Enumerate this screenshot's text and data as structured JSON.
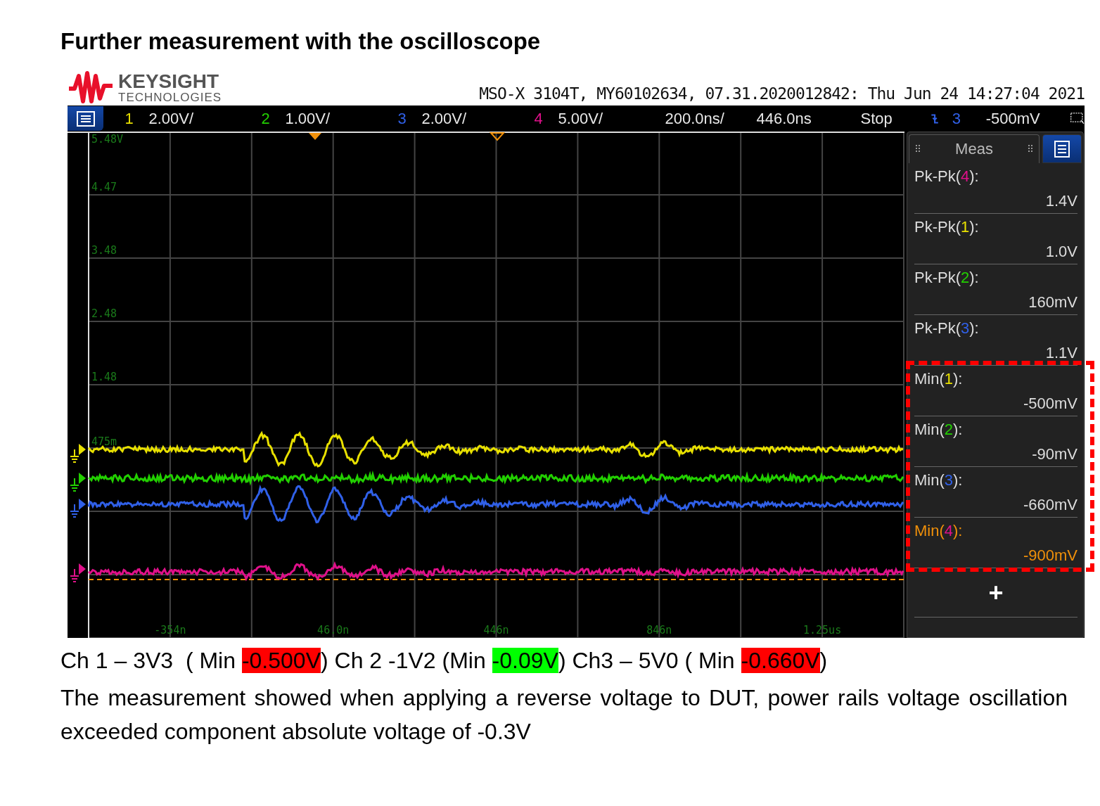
{
  "title": "Further measurement with the oscilloscope",
  "logo": {
    "brand": "KEYSIGHT",
    "subtitle": "TECHNOLOGIES"
  },
  "scope_header": "MSO-X 3104T, MY60102634, 07.31.2020012842: Thu Jun 24 14:27:04 2021",
  "channels": [
    {
      "number": "1",
      "scale": "2.00V/",
      "color": "#e8e000"
    },
    {
      "number": "2",
      "scale": "1.00V/",
      "color": "#22d000"
    },
    {
      "number": "3",
      "scale": "2.00V/",
      "color": "#3060e8"
    },
    {
      "number": "4",
      "scale": "5.00V/",
      "color": "#e0108a"
    }
  ],
  "timebase": {
    "scale": "200.0ns/",
    "delay": "446.0ns"
  },
  "run_state": "Stop",
  "trigger": {
    "source": "3",
    "level": "-500mV",
    "color": "#3060e8"
  },
  "graticule": {
    "y_labels": [
      "5.48V",
      "4.47",
      "3.48",
      "2.48",
      "1.48",
      "475m"
    ],
    "x_labels": [
      "-354n",
      "46.0n",
      "446n",
      "846n",
      "1.25us"
    ]
  },
  "meas_panel": {
    "title": "Meas",
    "items": [
      {
        "label": "Pk-Pk(",
        "channel": "4",
        "suffix": "):",
        "color": "#e0108a",
        "value": "1.4V",
        "selected": false
      },
      {
        "label": "Pk-Pk(",
        "channel": "1",
        "suffix": "):",
        "color": "#e8e000",
        "value": "1.0V",
        "selected": false
      },
      {
        "label": "Pk-Pk(",
        "channel": "2",
        "suffix": "):",
        "color": "#22d000",
        "value": "160mV",
        "selected": false
      },
      {
        "label": "Pk-Pk(",
        "channel": "3",
        "suffix": "):",
        "color": "#3060e8",
        "value": "1.1V",
        "selected": false
      },
      {
        "label": "Min(",
        "channel": "1",
        "suffix": "):",
        "color": "#e8e000",
        "value": "-500mV",
        "selected": false
      },
      {
        "label": "Min(",
        "channel": "2",
        "suffix": "):",
        "color": "#22d000",
        "value": "-90mV",
        "selected": false
      },
      {
        "label": "Min(",
        "channel": "3",
        "suffix": "):",
        "color": "#3060e8",
        "value": "-660mV",
        "selected": false
      },
      {
        "label": "Min(",
        "channel": "4",
        "suffix": "):",
        "color": "#e0108a",
        "value": "-900mV",
        "selected": true
      }
    ],
    "add_label": "+"
  },
  "caption": [
    {
      "text": "Ch 1 – 3V3  ( Min "
    },
    {
      "text": "-0.500V",
      "color": "#ff0000"
    },
    {
      "text": ") Ch 2 -1V2 (Min "
    },
    {
      "text": "-0.09V",
      "color": "#00ff00"
    },
    {
      "text": ") Ch3 – 5V0 ( Min "
    },
    {
      "text": "-0.660V",
      "color": "#ff0000"
    },
    {
      "text": ")"
    }
  ],
  "paragraph": "The measurement showed when applying a reverse voltage to DUT, power rails voltage oscillation exceeded component absolute voltage of -0.3V"
}
